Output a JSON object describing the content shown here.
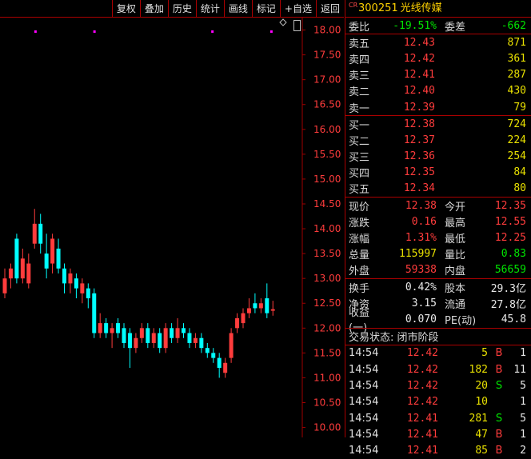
{
  "toolbar": {
    "buttons": [
      "复权",
      "叠加",
      "历史",
      "统计",
      "画线",
      "标记",
      "+自选",
      "返回"
    ]
  },
  "stock": {
    "badge": "CR",
    "code": "300251",
    "name": "光线传媒"
  },
  "weibi": {
    "label": "委比",
    "value": "-19.51%",
    "diff_label": "委差",
    "diff_value": "-662"
  },
  "asks": [
    {
      "label": "卖五",
      "price": "12.43",
      "vol": "871"
    },
    {
      "label": "卖四",
      "price": "12.42",
      "vol": "361"
    },
    {
      "label": "卖三",
      "price": "12.41",
      "vol": "287"
    },
    {
      "label": "卖二",
      "price": "12.40",
      "vol": "430"
    },
    {
      "label": "卖一",
      "price": "12.39",
      "vol": "79"
    }
  ],
  "bids": [
    {
      "label": "买一",
      "price": "12.38",
      "vol": "724"
    },
    {
      "label": "买二",
      "price": "12.37",
      "vol": "224"
    },
    {
      "label": "买三",
      "price": "12.36",
      "vol": "254"
    },
    {
      "label": "买四",
      "price": "12.35",
      "vol": "84"
    },
    {
      "label": "买五",
      "price": "12.34",
      "vol": "80"
    }
  ],
  "quote": [
    {
      "l1": "现价",
      "v1": "12.38",
      "c1": "red",
      "l2": "今开",
      "v2": "12.35",
      "c2": "red"
    },
    {
      "l1": "涨跌",
      "v1": "0.16",
      "c1": "red",
      "l2": "最高",
      "v2": "12.55",
      "c2": "red"
    },
    {
      "l1": "涨幅",
      "v1": "1.31%",
      "c1": "red",
      "l2": "最低",
      "v2": "12.25",
      "c2": "red"
    },
    {
      "l1": "总量",
      "v1": "115997",
      "c1": "yellow",
      "l2": "量比",
      "v2": "0.83",
      "c2": "green"
    },
    {
      "l1": "外盘",
      "v1": "59338",
      "c1": "red",
      "l2": "内盘",
      "v2": "56659",
      "c2": "green"
    }
  ],
  "finance": [
    {
      "l1": "换手",
      "v1": "0.42%",
      "l2": "股本",
      "v2": "29.3亿"
    },
    {
      "l1": "净资",
      "v1": "3.15",
      "l2": "流通",
      "v2": "27.8亿"
    },
    {
      "l1": "收益(一)",
      "v1": "0.070",
      "l2": "PE(动)",
      "v2": "45.8"
    }
  ],
  "trade_status": "交易状态: 闭市阶段",
  "ticks": [
    {
      "time": "14:54",
      "price": "12.42",
      "vol": "5",
      "dir": "B",
      "num": "1"
    },
    {
      "time": "14:54",
      "price": "12.42",
      "vol": "182",
      "dir": "B",
      "num": "11"
    },
    {
      "time": "14:54",
      "price": "12.42",
      "vol": "20",
      "dir": "S",
      "num": "5"
    },
    {
      "time": "14:54",
      "price": "12.42",
      "vol": "10",
      "dir": "",
      "num": "1"
    },
    {
      "time": "14:54",
      "price": "12.41",
      "vol": "281",
      "dir": "S",
      "num": "5"
    },
    {
      "time": "14:54",
      "price": "12.41",
      "vol": "47",
      "dir": "B",
      "num": "1"
    },
    {
      "time": "14:54",
      "price": "12.41",
      "vol": "85",
      "dir": "B",
      "num": "2"
    }
  ],
  "colors": {
    "up": "#ff3c3c",
    "down": "#00ffff",
    "grid": "#a00000",
    "axis_text": "#ff3c3c",
    "marker": "#ff00ff"
  },
  "chart_data": {
    "type": "candlestick",
    "ylim": [
      9.8,
      18.25
    ],
    "y_ticks": [
      "18.00",
      "17.50",
      "17.00",
      "16.50",
      "16.00",
      "15.50",
      "15.00",
      "14.50",
      "14.00",
      "13.50",
      "13.00",
      "12.50",
      "12.00",
      "11.50",
      "11.00",
      "10.50",
      "10.00"
    ],
    "candles": [
      {
        "o": 12.7,
        "c": 13.0,
        "h": 13.2,
        "l": 12.6
      },
      {
        "o": 13.0,
        "c": 13.2,
        "h": 13.3,
        "l": 12.8
      },
      {
        "o": 13.8,
        "c": 13.0,
        "h": 13.9,
        "l": 12.9
      },
      {
        "o": 13.0,
        "c": 13.4,
        "h": 13.6,
        "l": 12.9
      },
      {
        "o": 12.9,
        "c": 13.3,
        "h": 13.5,
        "l": 12.8
      },
      {
        "o": 13.7,
        "c": 14.1,
        "h": 14.4,
        "l": 13.6
      },
      {
        "o": 14.1,
        "c": 13.7,
        "h": 14.3,
        "l": 13.5
      },
      {
        "o": 13.5,
        "c": 13.2,
        "h": 13.9,
        "l": 13.0
      },
      {
        "o": 13.3,
        "c": 13.8,
        "h": 13.9,
        "l": 13.1
      },
      {
        "o": 13.6,
        "c": 13.2,
        "h": 13.8,
        "l": 13.1
      },
      {
        "o": 13.2,
        "c": 12.9,
        "h": 13.3,
        "l": 12.7
      },
      {
        "o": 12.9,
        "c": 13.1,
        "h": 13.2,
        "l": 12.7
      },
      {
        "o": 13.0,
        "c": 12.8,
        "h": 13.1,
        "l": 12.6
      },
      {
        "o": 12.7,
        "c": 12.9,
        "h": 13.0,
        "l": 12.5
      },
      {
        "o": 12.8,
        "c": 12.6,
        "h": 12.9,
        "l": 12.4
      },
      {
        "o": 12.7,
        "c": 11.9,
        "h": 12.8,
        "l": 11.8
      },
      {
        "o": 11.9,
        "c": 12.1,
        "h": 12.3,
        "l": 11.8
      },
      {
        "o": 12.1,
        "c": 11.9,
        "h": 12.2,
        "l": 11.8
      },
      {
        "o": 11.9,
        "c": 12.0,
        "h": 12.1,
        "l": 11.6
      },
      {
        "o": 12.1,
        "c": 11.9,
        "h": 12.2,
        "l": 11.8
      },
      {
        "o": 12.0,
        "c": 11.7,
        "h": 12.1,
        "l": 11.6
      },
      {
        "o": 11.9,
        "c": 11.6,
        "h": 12.0,
        "l": 11.2
      },
      {
        "o": 11.6,
        "c": 11.8,
        "h": 11.9,
        "l": 11.5
      },
      {
        "o": 11.8,
        "c": 12.0,
        "h": 12.1,
        "l": 11.7
      },
      {
        "o": 12.0,
        "c": 11.7,
        "h": 12.1,
        "l": 11.6
      },
      {
        "o": 11.7,
        "c": 11.9,
        "h": 12.0,
        "l": 11.6
      },
      {
        "o": 11.9,
        "c": 11.6,
        "h": 12.0,
        "l": 11.5
      },
      {
        "o": 11.6,
        "c": 12.0,
        "h": 12.1,
        "l": 11.5
      },
      {
        "o": 12.0,
        "c": 11.8,
        "h": 12.1,
        "l": 11.7
      },
      {
        "o": 11.8,
        "c": 12.0,
        "h": 12.2,
        "l": 11.7
      },
      {
        "o": 12.0,
        "c": 11.9,
        "h": 12.1,
        "l": 11.8
      },
      {
        "o": 11.9,
        "c": 11.7,
        "h": 12.0,
        "l": 11.6
      },
      {
        "o": 11.7,
        "c": 11.8,
        "h": 11.9,
        "l": 11.6
      },
      {
        "o": 11.8,
        "c": 11.6,
        "h": 11.9,
        "l": 11.5
      },
      {
        "o": 11.6,
        "c": 11.5,
        "h": 11.7,
        "l": 11.4
      },
      {
        "o": 11.5,
        "c": 11.4,
        "h": 11.6,
        "l": 11.3
      },
      {
        "o": 11.4,
        "c": 11.2,
        "h": 11.5,
        "l": 11.0
      },
      {
        "o": 11.1,
        "c": 11.3,
        "h": 11.4,
        "l": 11.0
      },
      {
        "o": 11.4,
        "c": 11.9,
        "h": 12.0,
        "l": 11.3
      },
      {
        "o": 12.0,
        "c": 12.2,
        "h": 12.3,
        "l": 11.9
      },
      {
        "o": 12.1,
        "c": 12.3,
        "h": 12.4,
        "l": 12.0
      },
      {
        "o": 12.3,
        "c": 12.4,
        "h": 12.6,
        "l": 12.2
      },
      {
        "o": 12.5,
        "c": 12.4,
        "h": 12.7,
        "l": 12.3
      },
      {
        "o": 12.4,
        "c": 12.5,
        "h": 12.6,
        "l": 12.3
      },
      {
        "o": 12.6,
        "c": 12.3,
        "h": 12.9,
        "l": 12.2
      },
      {
        "o": 12.35,
        "c": 12.38,
        "h": 12.55,
        "l": 12.25
      }
    ],
    "markers": [
      3,
      9,
      21,
      27,
      36,
      39,
      41,
      43,
      45
    ]
  }
}
